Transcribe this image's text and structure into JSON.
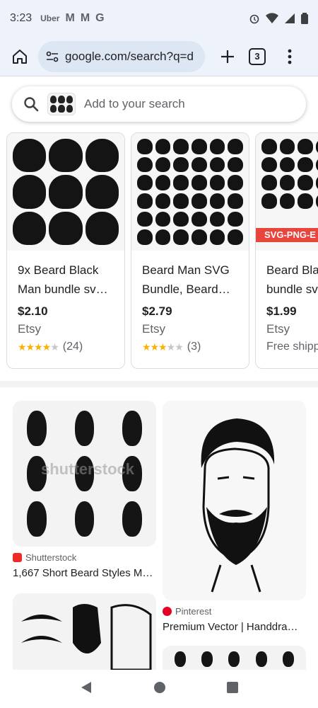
{
  "status": {
    "time": "3:23",
    "notifications": [
      "Uber",
      "M",
      "M",
      "G"
    ]
  },
  "toolbar": {
    "url": "google.com/search?q=d",
    "tab_count": "3"
  },
  "search": {
    "placeholder": "Add to your search"
  },
  "products": [
    {
      "title": "9x Beard Black Man bundle sv…",
      "price": "$2.10",
      "store": "Etsy",
      "rating": 4,
      "reviews": "(24)"
    },
    {
      "title": "Beard Man SVG Bundle, Beard…",
      "price": "$2.79",
      "store": "Etsy",
      "rating": 3,
      "reviews": "(3)"
    },
    {
      "title": "Beard Black Man bundle sv",
      "price": "$1.99",
      "store": "Etsy",
      "shipping": "Free shipping",
      "banner": "SVG-PNG-E"
    }
  ],
  "images": [
    {
      "source": "Shutterstock",
      "caption": "1,667 Short Beard Styles M…",
      "watermark": "shutterstock"
    },
    {
      "source": "Pinterest",
      "caption": "Premium Vector | Handdra…"
    }
  ],
  "colors": {
    "chrome_bg": "#eef3fb",
    "star": "#f9b203",
    "shutterstock": "#ee2b24",
    "pinterest": "#e60023"
  }
}
